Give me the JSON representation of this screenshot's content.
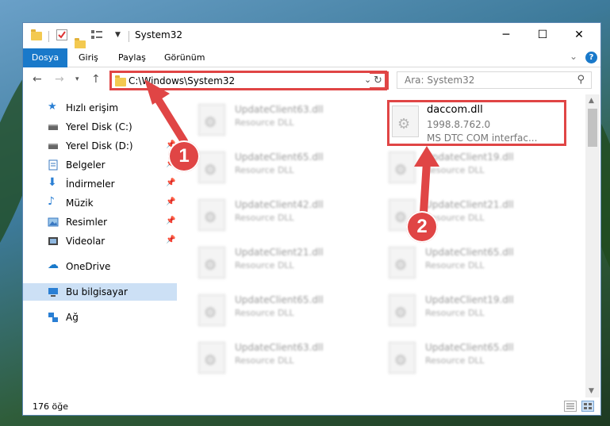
{
  "window": {
    "title": "System32"
  },
  "ribbon": {
    "tabs": [
      "Dosya",
      "Giriş",
      "Paylaş",
      "Görünüm"
    ]
  },
  "address": {
    "path": "C:\\Windows\\System32"
  },
  "search": {
    "placeholder": "Ara: System32"
  },
  "sidebar": {
    "items": [
      {
        "label": "Hızlı erişim",
        "icon": "star-icon"
      },
      {
        "label": "Yerel Disk (C:)",
        "icon": "drive-icon"
      },
      {
        "label": "Yerel Disk (D:)",
        "icon": "drive-icon"
      },
      {
        "label": "Belgeler",
        "icon": "documents-icon"
      },
      {
        "label": "İndirmeler",
        "icon": "download-icon"
      },
      {
        "label": "Müzik",
        "icon": "music-icon"
      },
      {
        "label": "Resimler",
        "icon": "pictures-icon"
      },
      {
        "label": "Videolar",
        "icon": "video-icon"
      },
      {
        "label": "OneDrive",
        "icon": "cloud-icon"
      },
      {
        "label": "Bu bilgisayar",
        "icon": "computer-icon"
      },
      {
        "label": "Ağ",
        "icon": "network-icon"
      }
    ]
  },
  "files": {
    "focused": {
      "name": "daccom.dll",
      "version": "1998.8.762.0",
      "description": "MS DTC COM interfac..."
    },
    "left_column": [
      {
        "name": "UpdateClient63.dll",
        "type": "Resource DLL"
      },
      {
        "name": "UpdateClient65.dll",
        "type": "Resource DLL"
      },
      {
        "name": "UpdateClient42.dll",
        "type": "Resource DLL"
      },
      {
        "name": "UpdateClient21.dll",
        "type": "Resource DLL"
      },
      {
        "name": "UpdateClient65.dll",
        "type": "Resource DLL"
      },
      {
        "name": "UpdateClient63.dll",
        "type": "Resource DLL"
      }
    ],
    "right_column": [
      {
        "name": "UpdateClient19.dll",
        "type": "Resource DLL"
      },
      {
        "name": "UpdateClient21.dll",
        "type": "Resource DLL"
      },
      {
        "name": "UpdateClient65.dll",
        "type": "Resource DLL"
      },
      {
        "name": "UpdateClient19.dll",
        "type": "Resource DLL"
      },
      {
        "name": "UpdateClient65.dll",
        "type": "Resource DLL"
      }
    ]
  },
  "status": {
    "count": "176 öğe"
  },
  "annotations": {
    "step1": "1",
    "step2": "2"
  },
  "colors": {
    "accent": "#1979ca",
    "highlight": "#e04545",
    "selected": "#cce0f5"
  }
}
